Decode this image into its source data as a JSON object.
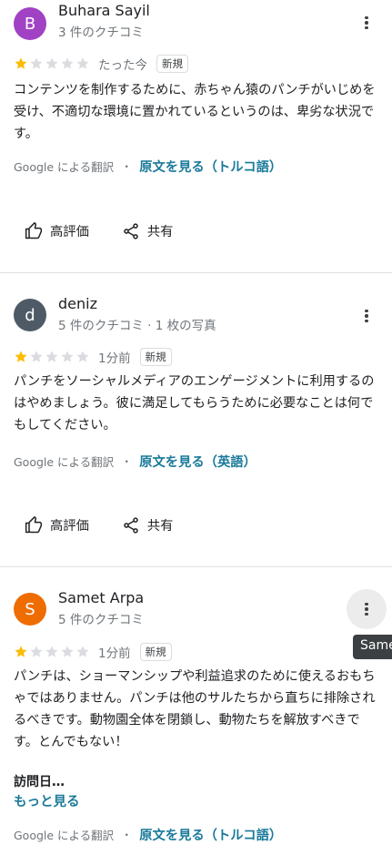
{
  "colors": {
    "star_filled": "#fbbc04",
    "star_empty": "#dadce0",
    "link": "#1a7a9a",
    "avatar_b": "#a142c4",
    "avatar_d": "#4e5b66",
    "avatar_s": "#ef6c00"
  },
  "reviews": [
    {
      "avatar_letter": "B",
      "name": "Buhara Sayil",
      "meta": "3 件のクチコミ",
      "rating": 1,
      "time": "たった今",
      "badge": "新規",
      "text": "コンテンツを制作するために、赤ちゃん猿のパンチがいじめを受け、不適切な環境に置かれているというのは、卑劣な状況です。",
      "translated_by": "Google による翻訳",
      "separator": "・",
      "see_original": "原文を見る（トルコ語）",
      "like_label": "高評価",
      "share_label": "共有"
    },
    {
      "avatar_letter": "d",
      "name": "deniz",
      "meta": "5 件のクチコミ · 1 枚の写真",
      "rating": 1,
      "time": "1分前",
      "badge": "新規",
      "text": "パンチをソーシャルメディアのエンゲージメントに利用するのはやめましょう。彼に満足してもらうために必要なことは何でもしてください。",
      "translated_by": "Google による翻訳",
      "separator": "・",
      "see_original": "原文を見る（英語）",
      "like_label": "高評価",
      "share_label": "共有"
    },
    {
      "avatar_letter": "S",
      "name": "Samet Arpa",
      "meta": "5 件のクチコミ",
      "rating": 1,
      "time": "1分前",
      "badge": "新規",
      "text": "パンチは、ショーマンシップや利益追求のために使えるおもちゃではありません。パンチは他のサルたちから直ちに排除されるべきです。動物園全体を閉鎖し、動物たちを解放すべきです。とんでもない！",
      "visit_label": "訪問日…",
      "more_label": "もっと見る",
      "translated_by": "Google による翻訳",
      "separator": "・",
      "see_original": "原文を見る（トルコ語）",
      "tooltip": "Same"
    }
  ]
}
